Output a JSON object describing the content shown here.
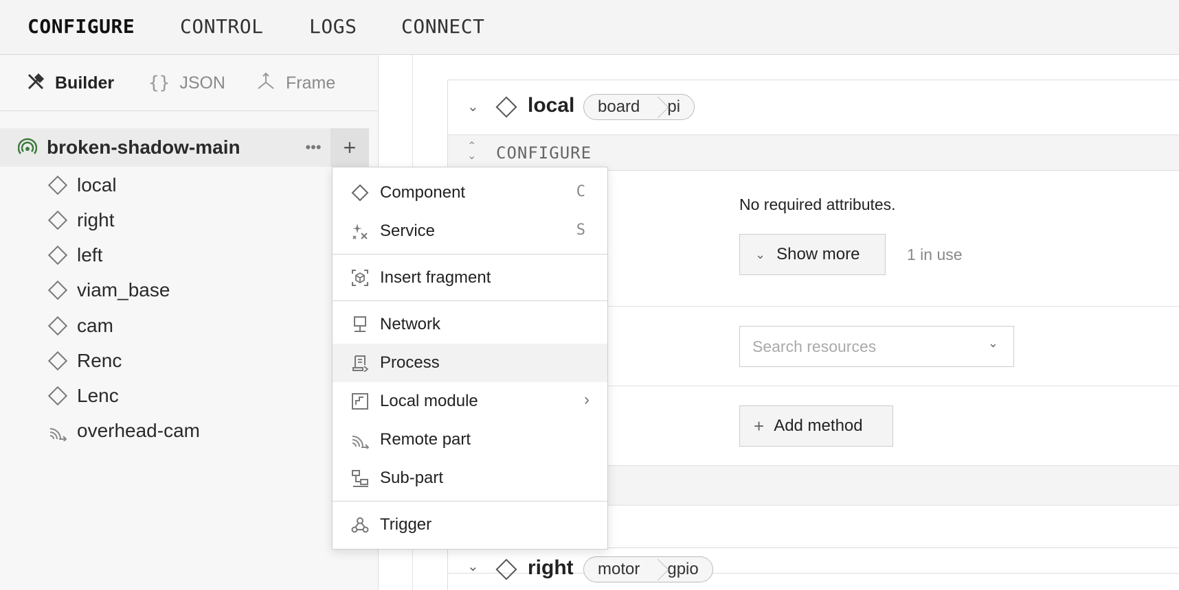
{
  "topnav": {
    "tabs": [
      {
        "label": "CONFIGURE",
        "active": true
      },
      {
        "label": "CONTROL",
        "active": false
      },
      {
        "label": "LOGS",
        "active": false
      },
      {
        "label": "CONNECT",
        "active": false
      }
    ]
  },
  "sidebar": {
    "subtabs": [
      {
        "label": "Builder",
        "icon": "tools-icon",
        "active": true
      },
      {
        "label": "JSON",
        "icon": "braces-icon",
        "active": false
      },
      {
        "label": "Frame",
        "icon": "axes-icon",
        "active": false
      }
    ],
    "robot": {
      "name": "broken-shadow-main",
      "icon": "signal-icon",
      "status_color": "#3f7a3f"
    },
    "items": [
      {
        "label": "local",
        "icon": "diamond-icon"
      },
      {
        "label": "right",
        "icon": "diamond-icon"
      },
      {
        "label": "left",
        "icon": "diamond-icon"
      },
      {
        "label": "viam_base",
        "icon": "diamond-icon"
      },
      {
        "label": "cam",
        "icon": "diamond-icon"
      },
      {
        "label": "Renc",
        "icon": "diamond-icon"
      },
      {
        "label": "Lenc",
        "icon": "diamond-icon"
      },
      {
        "label": "overhead-cam",
        "icon": "remote-part-icon"
      }
    ]
  },
  "menu": {
    "items": [
      {
        "label": "Component",
        "shortcut": "C",
        "icon": "diamond-icon"
      },
      {
        "label": "Service",
        "shortcut": "S",
        "icon": "sparkle-icon"
      },
      {
        "label": "Insert fragment",
        "icon": "fragment-icon"
      },
      {
        "label": "Network",
        "icon": "network-icon"
      },
      {
        "label": "Process",
        "icon": "process-icon",
        "highlighted": true
      },
      {
        "label": "Local module",
        "icon": "module-icon",
        "submenu": true
      },
      {
        "label": "Remote part",
        "icon": "remote-part-icon"
      },
      {
        "label": "Sub-part",
        "icon": "sub-part-icon"
      },
      {
        "label": "Trigger",
        "icon": "webhook-icon"
      }
    ]
  },
  "main": {
    "card1": {
      "title": "local",
      "api": "board",
      "model": "pi",
      "configure_label": "CONFIGURE",
      "no_required": "No required attributes.",
      "show_more": "Show more",
      "in_use": "1 in use",
      "search_placeholder": "Search resources",
      "add_method": "Add method"
    },
    "card2": {
      "title": "right",
      "api": "motor",
      "model": "gpio"
    }
  }
}
